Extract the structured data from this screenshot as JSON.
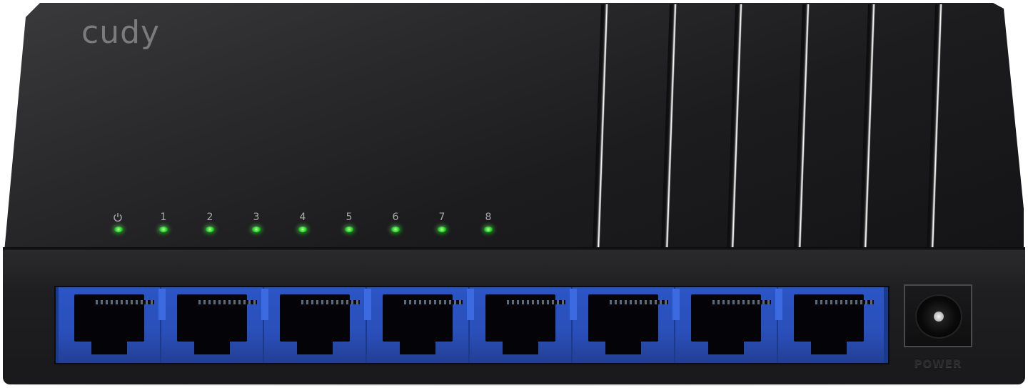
{
  "device": {
    "brand_logo": "cudy",
    "led_labels": [
      "1",
      "2",
      "3",
      "4",
      "5",
      "6",
      "7",
      "8"
    ],
    "power_led_icon": "power-icon",
    "led_color": "#3ce03a",
    "port_color": "#2b55c6",
    "port_count": 8,
    "power_jack_label": "POWER"
  }
}
